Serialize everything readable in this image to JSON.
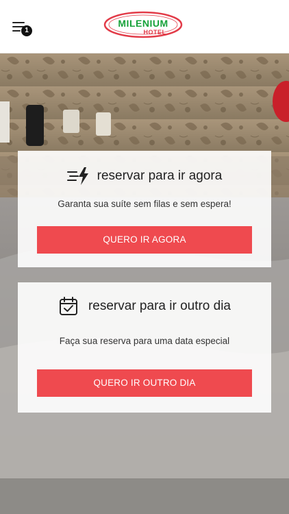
{
  "header": {
    "notification_count": "1",
    "logo": {
      "name": "MILENIUM",
      "subtitle": "HOTEL"
    }
  },
  "cards": [
    {
      "icon": "lightning-speed-icon",
      "title": "reservar para ir agora",
      "description": "Garanta sua suíte sem filas e sem espera!",
      "button_label": "QUERO IR AGORA"
    },
    {
      "icon": "calendar-check-icon",
      "title": "reservar para ir outro dia",
      "description": "Faça sua reserva para uma data especial",
      "button_label": "QUERO IR OUTRO DIA"
    }
  ],
  "colors": {
    "accent": "#ef4a4f",
    "logo_green": "#17a23a",
    "logo_red": "#e23b48"
  }
}
